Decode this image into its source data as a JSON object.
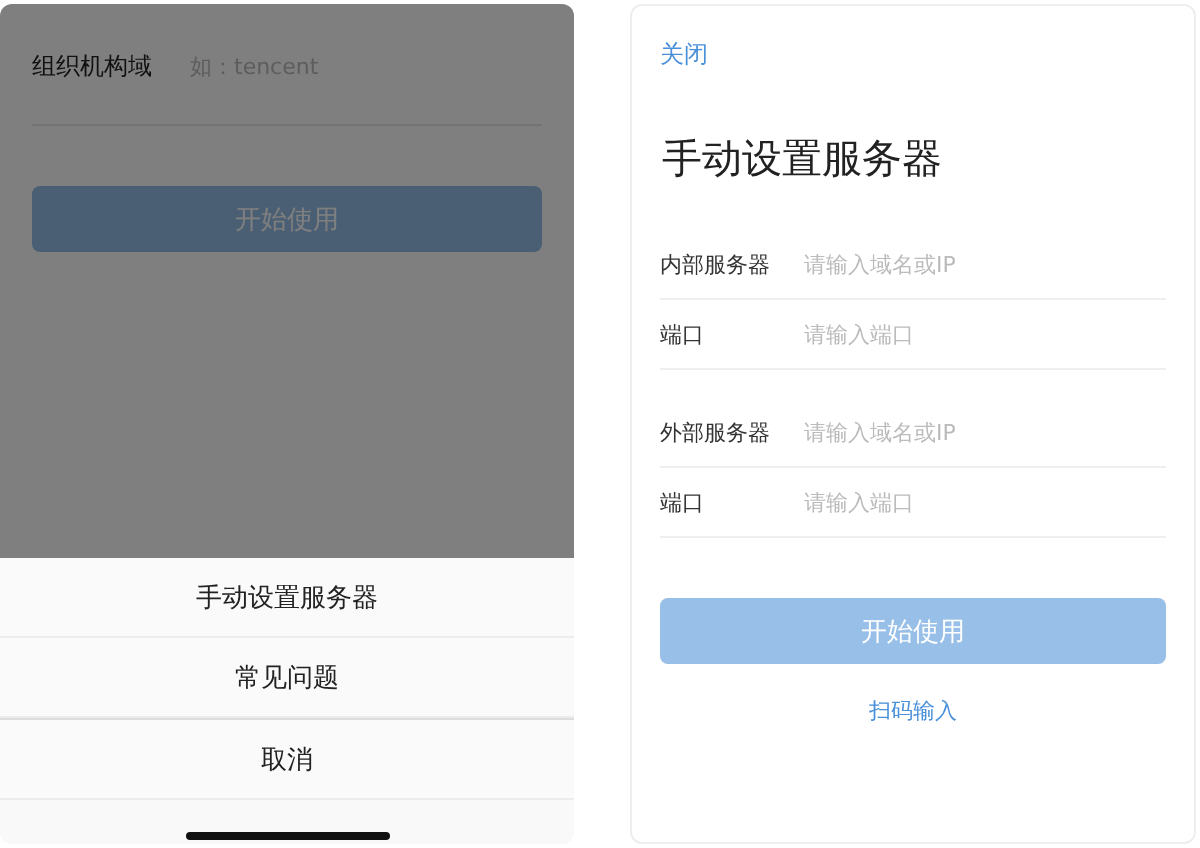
{
  "left_screen": {
    "form": {
      "label": "组织机构域",
      "placeholder": "如：tencent"
    },
    "start_button": {
      "label": "开始使用",
      "disabled": true
    },
    "dimmed": true,
    "action_sheet": {
      "items": [
        "手动设置服务器",
        "常见问题"
      ],
      "cancel": "取消"
    }
  },
  "right_screen": {
    "close": "关闭",
    "title": "手动设置服务器",
    "groups": [
      {
        "fields": [
          {
            "label": "内部服务器",
            "placeholder": "请输入域名或IP"
          },
          {
            "label": "端口",
            "placeholder": "请输入端口"
          }
        ]
      },
      {
        "fields": [
          {
            "label": "外部服务器",
            "placeholder": "请输入域名或IP"
          },
          {
            "label": "端口",
            "placeholder": "请输入端口"
          }
        ]
      }
    ],
    "start_button": {
      "label": "开始使用",
      "disabled": true
    },
    "scan_link": "扫码输入"
  }
}
